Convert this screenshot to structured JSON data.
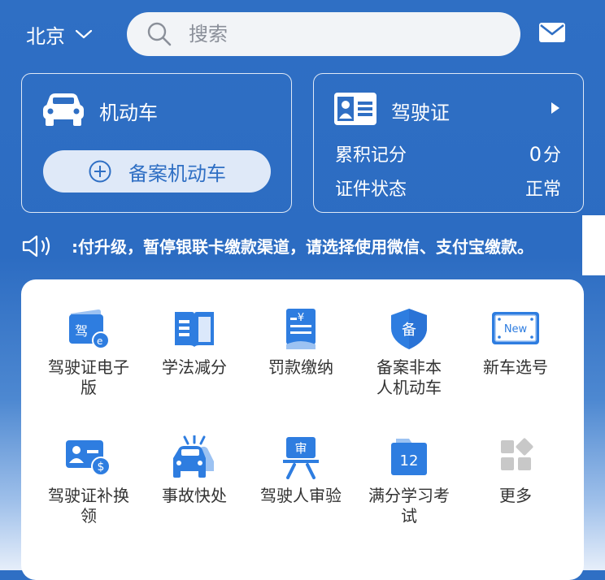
{
  "header": {
    "city": "北京",
    "search_placeholder": "搜索"
  },
  "vehicle_card": {
    "title": "机动车",
    "register_button": "备案机动车"
  },
  "license_card": {
    "title": "驾驶证",
    "points_label": "累积记分",
    "points_value": "0",
    "points_unit": "分",
    "status_label": "证件状态",
    "status_value": "正常"
  },
  "notice": {
    "text": ":付升级，暂停银联卡缴款渠道，请选择使用微信、支付宝缴款。"
  },
  "services": [
    {
      "label": "驾驶证电子版",
      "icon": "e-license-icon"
    },
    {
      "label": "学法减分",
      "icon": "book-icon"
    },
    {
      "label": "罚款缴纳",
      "icon": "fine-receipt-icon"
    },
    {
      "label": "备案非本人机动车",
      "icon": "shield-icon"
    },
    {
      "label": "新车选号",
      "icon": "new-plate-icon"
    },
    {
      "label": "驾驶证补换领",
      "icon": "license-renew-icon"
    },
    {
      "label": "事故快处",
      "icon": "car-accident-icon"
    },
    {
      "label": "驾驶人审验",
      "icon": "review-icon"
    },
    {
      "label": "满分学习考试",
      "icon": "calendar-12-icon"
    },
    {
      "label": "更多",
      "icon": "more-grid-icon"
    }
  ],
  "colors": {
    "accent": "#2f6fc4",
    "icon_blue": "#2e7de0",
    "icon_light": "#9cc2f2"
  }
}
